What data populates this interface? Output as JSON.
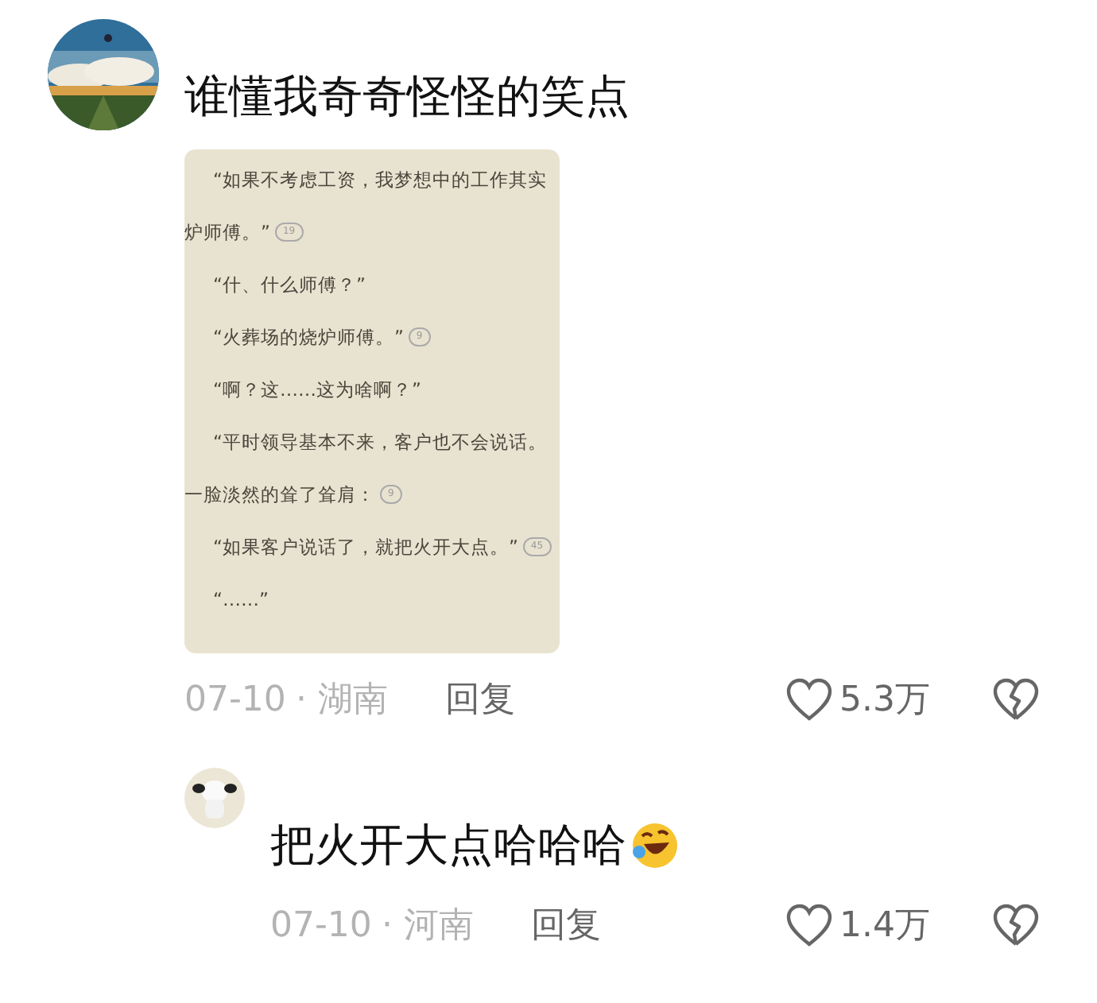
{
  "comments": [
    {
      "text": "谁懂我奇奇怪怪的笑点",
      "trailing_emoji": false,
      "image": {
        "lines": [
          {
            "text": "“如果不考虑工资，我梦想中的工作其实",
            "indent": true
          },
          {
            "text": "炉师傅。”",
            "indent": false,
            "badge": "19"
          },
          {
            "text": "“什、什么师傅？”",
            "indent": true
          },
          {
            "text": "“火葬场的烧炉师傅。”",
            "indent": true,
            "badge": "9"
          },
          {
            "text": "“啊？这……这为啥啊？”",
            "indent": true
          },
          {
            "text": "“平时领导基本不来，客户也不会说话。",
            "indent": true
          },
          {
            "text": "一脸淡然的耸了耸肩：",
            "indent": false,
            "badge": "9"
          },
          {
            "text": "“如果客户说话了，就把火开大点。”",
            "indent": true,
            "badge": "45"
          },
          {
            "text": "“……”",
            "indent": true
          }
        ]
      },
      "date": "07-10",
      "region": "· 湖南",
      "reply": "回复",
      "likes": "5.3万"
    },
    {
      "text": "把火开大点哈哈哈",
      "trailing_emoji": true,
      "date": "07-10",
      "region": "· 河南",
      "reply": "回复",
      "likes": "1.4万"
    }
  ]
}
